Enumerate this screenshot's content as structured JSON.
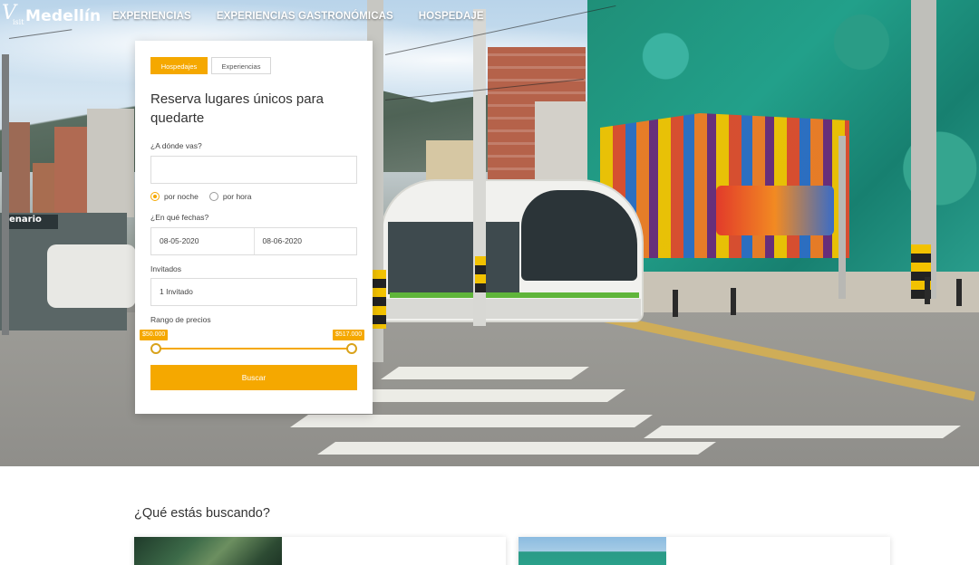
{
  "nav": {
    "logo_script": "V",
    "logo_sub": "isit",
    "logo_main": "Medellín",
    "links": [
      "EXPERIENCIAS",
      "EXPERIENCIAS GASTRONÓMICAS",
      "HOSPEDAJE"
    ]
  },
  "hero": {
    "station_sign": "enario"
  },
  "booking": {
    "tabs": [
      "Hospedajes",
      "Experiencias"
    ],
    "active_tab": "Hospedajes",
    "title": "Reserva lugares únicos para quedarte",
    "where_label": "¿A dónde vas?",
    "where_value": "",
    "stay_options": [
      "por noche",
      "por hora"
    ],
    "stay_selected": "por noche",
    "dates_label": "¿En qué fechas?",
    "date_start": "08-05-2020",
    "date_end": "08-06-2020",
    "guests_label": "Invitados",
    "guests_value": "1 Invitado",
    "price_label": "Rango de precios",
    "price_min": "$50.000",
    "price_max": "$517.000",
    "search_button": "Buscar"
  },
  "section": {
    "title": "¿Qué estás buscando?"
  },
  "colors": {
    "accent": "#f5a800",
    "text": "#333333",
    "border": "#dcdcdc"
  },
  "icons": {
    "radio_checked": "radio-checked-icon",
    "radio_unchecked": "radio-unchecked-icon"
  }
}
